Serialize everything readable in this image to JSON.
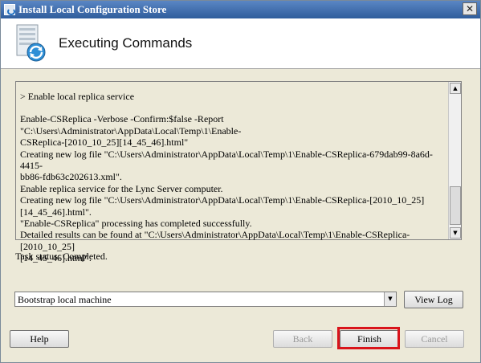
{
  "window": {
    "title": "Install Local Configuration Store",
    "close_glyph": "✕"
  },
  "header": {
    "icon": "server-sync-icon",
    "title": "Executing Commands"
  },
  "log": {
    "lines": [
      "> Enable local replica service",
      "",
      "Enable-CSReplica -Verbose -Confirm:$false -Report \"C:\\Users\\Administrator\\AppData\\Local\\Temp\\1\\Enable-",
      "CSReplica-[2010_10_25][14_45_46].html\"",
      "Creating new log file \"C:\\Users\\Administrator\\AppData\\Local\\Temp\\1\\Enable-CSReplica-679dab99-8a6d-4415-",
      "bb86-fdb63c202613.xml\".",
      "Enable replica service for the Lync Server computer.",
      "Creating new log file \"C:\\Users\\Administrator\\AppData\\Local\\Temp\\1\\Enable-CSReplica-[2010_10_25]",
      "[14_45_46].html\".",
      "\"Enable-CSReplica\" processing has completed successfully.",
      "Detailed results can be found at \"C:\\Users\\Administrator\\AppData\\Local\\Temp\\1\\Enable-CSReplica-[2010_10_25]",
      "[14_45_46].html\"."
    ],
    "scroll_up_glyph": "▲",
    "scroll_down_glyph": "▼"
  },
  "status": {
    "text": "Task status: Completed."
  },
  "combo": {
    "selected": "Bootstrap local machine",
    "arrow_glyph": "▼"
  },
  "buttons": {
    "view_log": "View Log",
    "help": "Help",
    "back": "Back",
    "finish": "Finish",
    "cancel": "Cancel"
  },
  "colors": {
    "highlight": "#d9141b",
    "title_bar": "#3a6aab",
    "dialog_bg": "#ece9d8"
  }
}
